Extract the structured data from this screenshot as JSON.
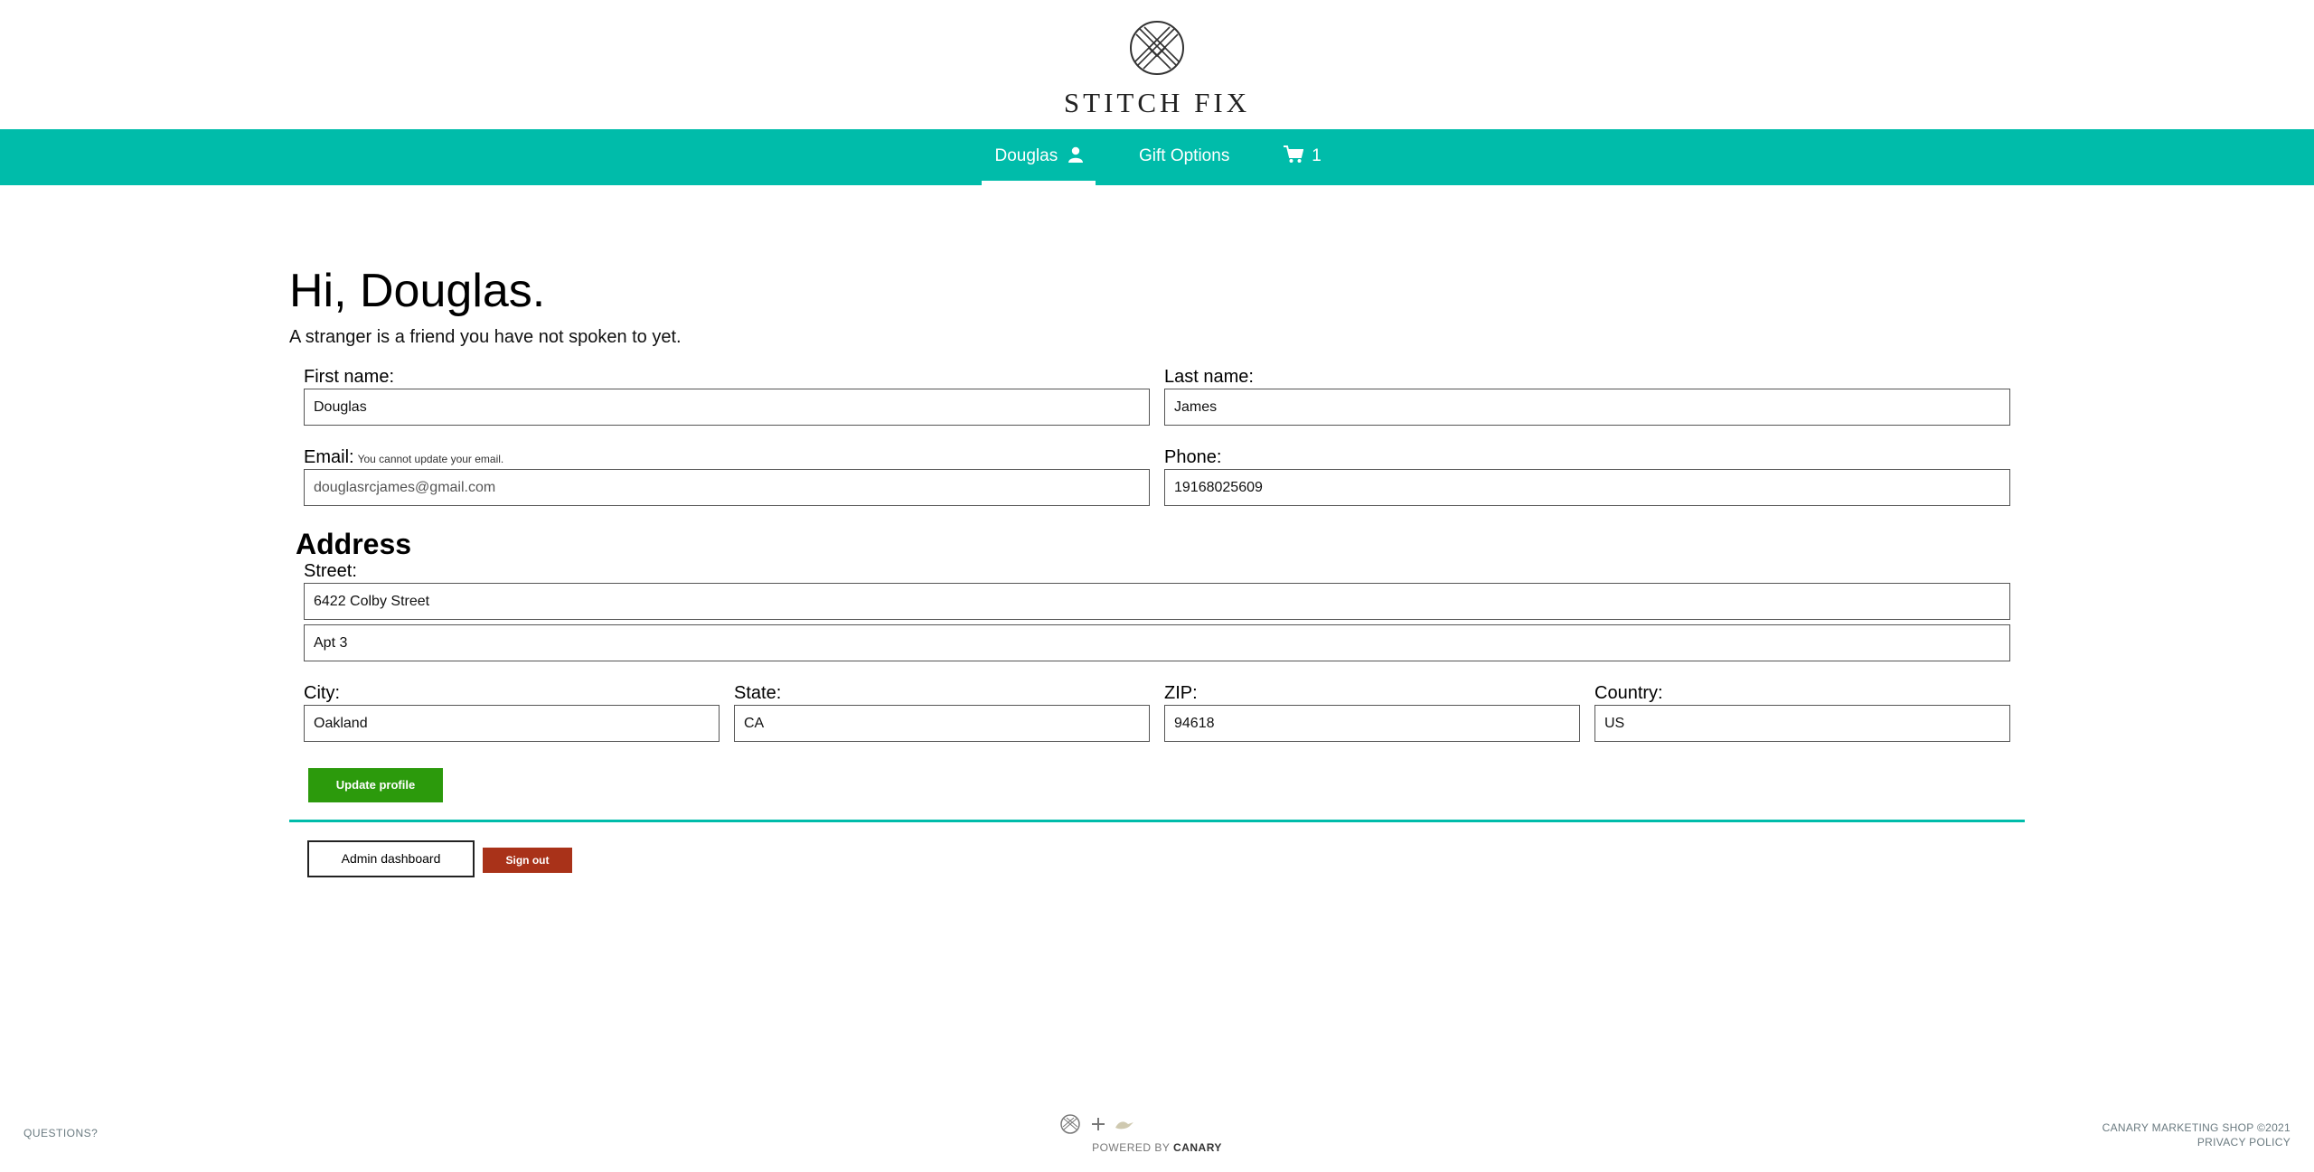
{
  "brand": {
    "name": "STITCH FIX",
    "logo_icon": "stitch-fix-logo-icon"
  },
  "nav": {
    "user_label": "Douglas",
    "gift_label": "Gift Options",
    "cart_count": "1",
    "accent_color": "#00bcaa"
  },
  "profile": {
    "greeting": "Hi, Douglas.",
    "subtitle": "A stranger is a friend you have not spoken to yet.",
    "first_name_label": "First name:",
    "first_name": "Douglas",
    "last_name_label": "Last name:",
    "last_name": "James",
    "email_label": "Email:",
    "email_hint": "You cannot update your email.",
    "email": "douglasrcjames@gmail.com",
    "phone_label": "Phone:",
    "phone": "19168025609"
  },
  "address": {
    "section_title": "Address",
    "street_label": "Street:",
    "street1": "6422 Colby Street",
    "street2": "Apt 3",
    "city_label": "City:",
    "city": "Oakland",
    "state_label": "State:",
    "state": "CA",
    "zip_label": "ZIP:",
    "zip": "94618",
    "country_label": "Country:",
    "country": "US"
  },
  "actions": {
    "update_label": "Update profile",
    "admin_label": "Admin dashboard",
    "signout_label": "Sign out",
    "update_color": "#2c9a0c",
    "signout_color": "#a93219"
  },
  "footer": {
    "questions": "QUESTIONS?",
    "powered_by": "POWERED BY",
    "powered_brand": "CANARY",
    "copyright": "CANARY MARKETING SHOP ©2021",
    "privacy": "PRIVACY POLICY"
  }
}
